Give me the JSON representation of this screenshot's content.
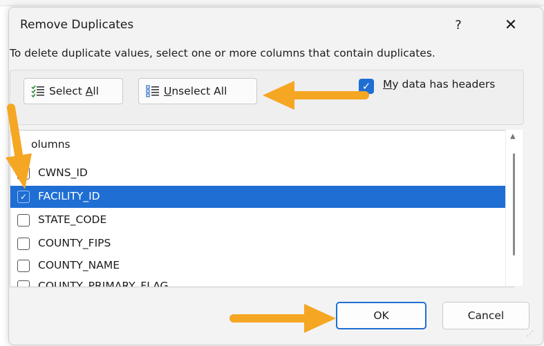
{
  "dialog": {
    "title": "Remove Duplicates",
    "help_label": "?",
    "close_label": "✕"
  },
  "instructions": "To delete duplicate values, select one or more columns that contain duplicates.",
  "buttons": {
    "select_all": {
      "prefix": "Select ",
      "accel": "A",
      "suffix": "ll"
    },
    "unselect_all": {
      "prefix": "",
      "accel": "U",
      "suffix": "nselect All"
    }
  },
  "headers_option": {
    "accel": "M",
    "suffix": "y data has headers",
    "checked": true
  },
  "columns": {
    "header": "olumns",
    "items": [
      {
        "label": "CWNS_ID",
        "checked": false
      },
      {
        "label": "FACILITY_ID",
        "checked": true,
        "selected": true
      },
      {
        "label": "STATE_CODE",
        "checked": false
      },
      {
        "label": "COUNTY_FIPS",
        "checked": false
      },
      {
        "label": "COUNTY_NAME",
        "checked": false
      },
      {
        "label": "COUNTY_PRIMARY_FLAG",
        "checked": false
      }
    ]
  },
  "footer": {
    "ok_label": "OK",
    "cancel_label": "Cancel"
  },
  "colors": {
    "accent": "#1f6ed4",
    "annotation_arrow": "#f5a623"
  },
  "icons": [
    "select-all-list-icon",
    "unselect-all-list-icon",
    "check-icon"
  ]
}
